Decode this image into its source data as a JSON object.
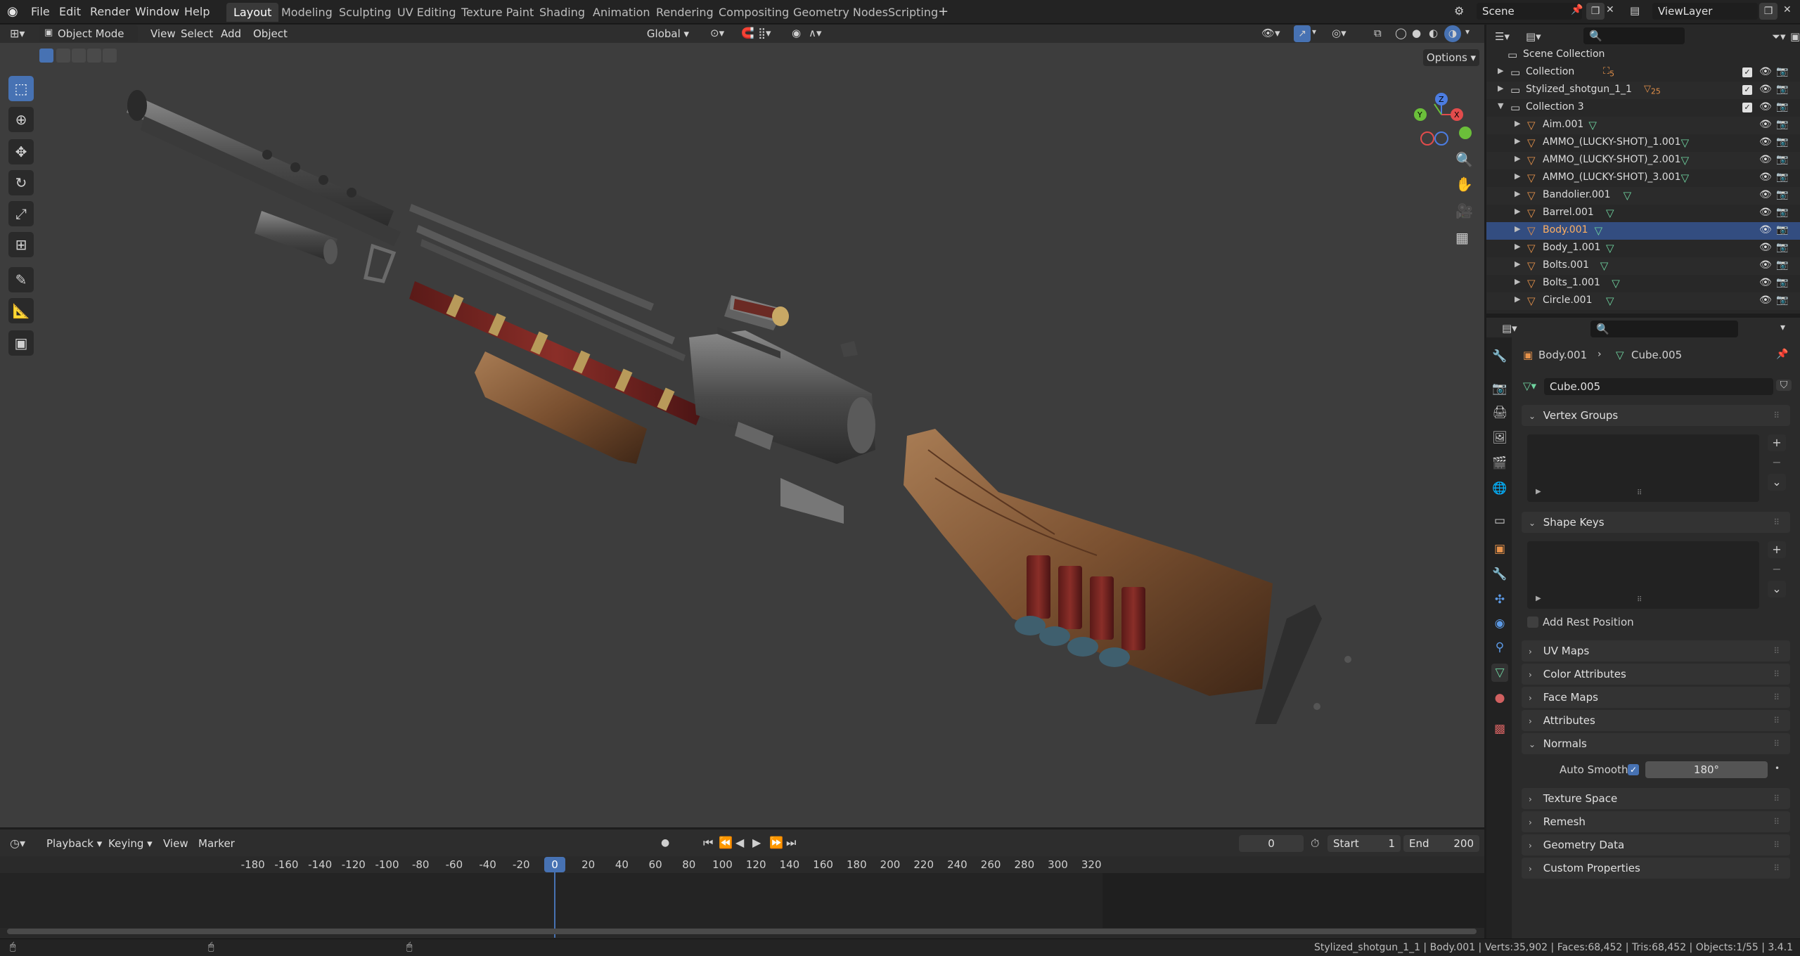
{
  "menu": {
    "file": "File",
    "edit": "Edit",
    "render": "Render",
    "window": "Window",
    "help": "Help"
  },
  "workspaces": [
    "Layout",
    "Modeling",
    "Sculpting",
    "UV Editing",
    "Texture Paint",
    "Shading",
    "Animation",
    "Rendering",
    "Compositing",
    "Geometry Nodes",
    "Scripting"
  ],
  "scene": {
    "name": "Scene",
    "view_layer": "ViewLayer"
  },
  "viewport": {
    "mode": "Object Mode",
    "menus": {
      "view": "View",
      "select": "Select",
      "add": "Add",
      "object": "Object"
    },
    "orientation": "Global",
    "options": "Options"
  },
  "timeline": {
    "menus": {
      "playback": "Playback",
      "keying": "Keying",
      "view": "View",
      "marker": "Marker"
    },
    "current_frame": "0",
    "start_label": "Start",
    "start": "1",
    "end_label": "End",
    "end": "200",
    "ticks": [
      "-180",
      "-160",
      "-140",
      "-120",
      "-100",
      "-80",
      "-60",
      "-40",
      "-20",
      "0",
      "20",
      "40",
      "60",
      "80",
      "100",
      "120",
      "140",
      "160",
      "180",
      "200",
      "220",
      "240",
      "260",
      "280",
      "300",
      "320"
    ]
  },
  "outliner": {
    "scene_collection": "Scene Collection",
    "rows": [
      {
        "label": "Collection",
        "level": 1
      },
      {
        "label": "Stylized_shotgun_1_1",
        "level": 1
      },
      {
        "label": "Collection 3",
        "level": 1
      },
      {
        "label": "Aim.001",
        "level": 2
      },
      {
        "label": "AMMO_(LUCKY-SHOT)_1.001",
        "level": 2
      },
      {
        "label": "AMMO_(LUCKY-SHOT)_2.001",
        "level": 2
      },
      {
        "label": "AMMO_(LUCKY-SHOT)_3.001",
        "level": 2
      },
      {
        "label": "Bandolier.001",
        "level": 2
      },
      {
        "label": "Barrel.001",
        "level": 2
      },
      {
        "label": "Body.001",
        "level": 2
      },
      {
        "label": "Body_1.001",
        "level": 2
      },
      {
        "label": "Bolts.001",
        "level": 2
      },
      {
        "label": "Bolts_1.001",
        "level": 2
      },
      {
        "label": "Circle.001",
        "level": 2
      }
    ],
    "selected": "Body.001",
    "collection_count": "5",
    "shotgun_count": "25"
  },
  "properties": {
    "object": "Body.001",
    "mesh": "Cube.005",
    "mesh_field": "Cube.005",
    "panels": {
      "vertex_groups": "Vertex Groups",
      "shape_keys": "Shape Keys",
      "add_rest_position": "Add Rest Position",
      "uv_maps": "UV Maps",
      "color_attributes": "Color Attributes",
      "face_maps": "Face Maps",
      "attributes": "Attributes",
      "normals": "Normals",
      "auto_smooth": "Auto Smooth",
      "auto_smooth_angle": "180°",
      "texture_space": "Texture Space",
      "remesh": "Remesh",
      "geometry_data": "Geometry Data",
      "custom_properties": "Custom Properties"
    }
  },
  "status": "Stylized_shotgun_1_1 | Body.001 | Verts:35,902 | Faces:68,452 | Tris:68,452 | Objects:1/55 | 3.4.1",
  "colors": {
    "accent": "#4772b3",
    "selection": "#334d80",
    "mesh_green": "#6fd4a0",
    "object_orange": "#e6924a"
  }
}
